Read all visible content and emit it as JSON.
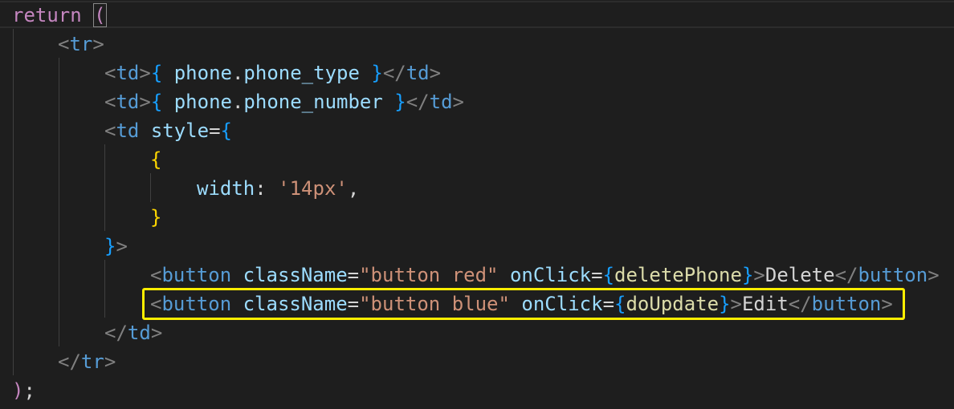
{
  "colors": {
    "background": "#1e1e1e",
    "keyword": "#c586c0",
    "tag_punctuation": "#808080",
    "tag_name": "#569cd6",
    "attribute": "#9cdcfe",
    "string": "#ce9178",
    "brace": "#ffd700",
    "jsx_brace": "#179fff",
    "function": "#dcdcaa",
    "text": "#d4d4d4",
    "highlight_box": "#ffee00"
  },
  "code": {
    "lines": [
      [
        {
          "t": "return",
          "c": "keyword"
        },
        {
          "t": " ",
          "c": "text"
        },
        {
          "t": "(",
          "c": "keyword",
          "cursor": true
        }
      ],
      [
        {
          "t": "<",
          "c": "tag_punctuation"
        },
        {
          "t": "tr",
          "c": "tag_name"
        },
        {
          "t": ">",
          "c": "tag_punctuation"
        }
      ],
      [
        {
          "t": "<",
          "c": "tag_punctuation"
        },
        {
          "t": "td",
          "c": "tag_name"
        },
        {
          "t": ">",
          "c": "tag_punctuation"
        },
        {
          "t": "{",
          "c": "jsx_brace"
        },
        {
          "t": " phone",
          "c": "attribute"
        },
        {
          "t": ".",
          "c": "text"
        },
        {
          "t": "phone_type",
          "c": "attribute"
        },
        {
          "t": " ",
          "c": "text"
        },
        {
          "t": "}",
          "c": "jsx_brace"
        },
        {
          "t": "</",
          "c": "tag_punctuation"
        },
        {
          "t": "td",
          "c": "tag_name"
        },
        {
          "t": ">",
          "c": "tag_punctuation"
        }
      ],
      [
        {
          "t": "<",
          "c": "tag_punctuation"
        },
        {
          "t": "td",
          "c": "tag_name"
        },
        {
          "t": ">",
          "c": "tag_punctuation"
        },
        {
          "t": "{",
          "c": "jsx_brace"
        },
        {
          "t": " phone",
          "c": "attribute"
        },
        {
          "t": ".",
          "c": "text"
        },
        {
          "t": "phone_number",
          "c": "attribute"
        },
        {
          "t": " ",
          "c": "text"
        },
        {
          "t": "}",
          "c": "jsx_brace"
        },
        {
          "t": "</",
          "c": "tag_punctuation"
        },
        {
          "t": "td",
          "c": "tag_name"
        },
        {
          "t": ">",
          "c": "tag_punctuation"
        }
      ],
      [
        {
          "t": "<",
          "c": "tag_punctuation"
        },
        {
          "t": "td",
          "c": "tag_name"
        },
        {
          "t": " ",
          "c": "text"
        },
        {
          "t": "style",
          "c": "attribute"
        },
        {
          "t": "=",
          "c": "text"
        },
        {
          "t": "{",
          "c": "jsx_brace"
        }
      ],
      [
        {
          "t": "{",
          "c": "brace"
        }
      ],
      [
        {
          "t": "width",
          "c": "attribute"
        },
        {
          "t": ": ",
          "c": "text"
        },
        {
          "t": "'14px'",
          "c": "string"
        },
        {
          "t": ",",
          "c": "text"
        }
      ],
      [
        {
          "t": "}",
          "c": "brace"
        }
      ],
      [
        {
          "t": "}",
          "c": "jsx_brace"
        },
        {
          "t": ">",
          "c": "tag_punctuation"
        }
      ],
      [
        {
          "t": "<",
          "c": "tag_punctuation"
        },
        {
          "t": "button",
          "c": "tag_name"
        },
        {
          "t": " ",
          "c": "text"
        },
        {
          "t": "className",
          "c": "attribute"
        },
        {
          "t": "=",
          "c": "text"
        },
        {
          "t": "\"button red\"",
          "c": "string"
        },
        {
          "t": " ",
          "c": "text"
        },
        {
          "t": "onClick",
          "c": "attribute"
        },
        {
          "t": "=",
          "c": "text"
        },
        {
          "t": "{",
          "c": "jsx_brace"
        },
        {
          "t": "deletePhone",
          "c": "function"
        },
        {
          "t": "}",
          "c": "jsx_brace"
        },
        {
          "t": ">",
          "c": "tag_punctuation"
        },
        {
          "t": "Delete",
          "c": "text"
        },
        {
          "t": "</",
          "c": "tag_punctuation"
        },
        {
          "t": "button",
          "c": "tag_name"
        },
        {
          "t": ">",
          "c": "tag_punctuation"
        }
      ],
      [
        {
          "t": "<",
          "c": "tag_punctuation"
        },
        {
          "t": "button",
          "c": "tag_name"
        },
        {
          "t": " ",
          "c": "text"
        },
        {
          "t": "className",
          "c": "attribute"
        },
        {
          "t": "=",
          "c": "text"
        },
        {
          "t": "\"button blue\"",
          "c": "string"
        },
        {
          "t": " ",
          "c": "text"
        },
        {
          "t": "onClick",
          "c": "attribute"
        },
        {
          "t": "=",
          "c": "text"
        },
        {
          "t": "{",
          "c": "jsx_brace"
        },
        {
          "t": "doUpdate",
          "c": "function"
        },
        {
          "t": "}",
          "c": "jsx_brace"
        },
        {
          "t": ">",
          "c": "tag_punctuation"
        },
        {
          "t": "Edit",
          "c": "text"
        },
        {
          "t": "</",
          "c": "tag_punctuation"
        },
        {
          "t": "button",
          "c": "tag_name"
        },
        {
          "t": ">",
          "c": "tag_punctuation"
        }
      ],
      [
        {
          "t": "</",
          "c": "tag_punctuation"
        },
        {
          "t": "td",
          "c": "tag_name"
        },
        {
          "t": ">",
          "c": "tag_punctuation"
        }
      ],
      [
        {
          "t": "</",
          "c": "tag_punctuation"
        },
        {
          "t": "tr",
          "c": "tag_name"
        },
        {
          "t": ">",
          "c": "tag_punctuation"
        }
      ],
      [
        {
          "t": ")",
          "c": "keyword"
        },
        {
          "t": ";",
          "c": "text"
        }
      ]
    ]
  }
}
